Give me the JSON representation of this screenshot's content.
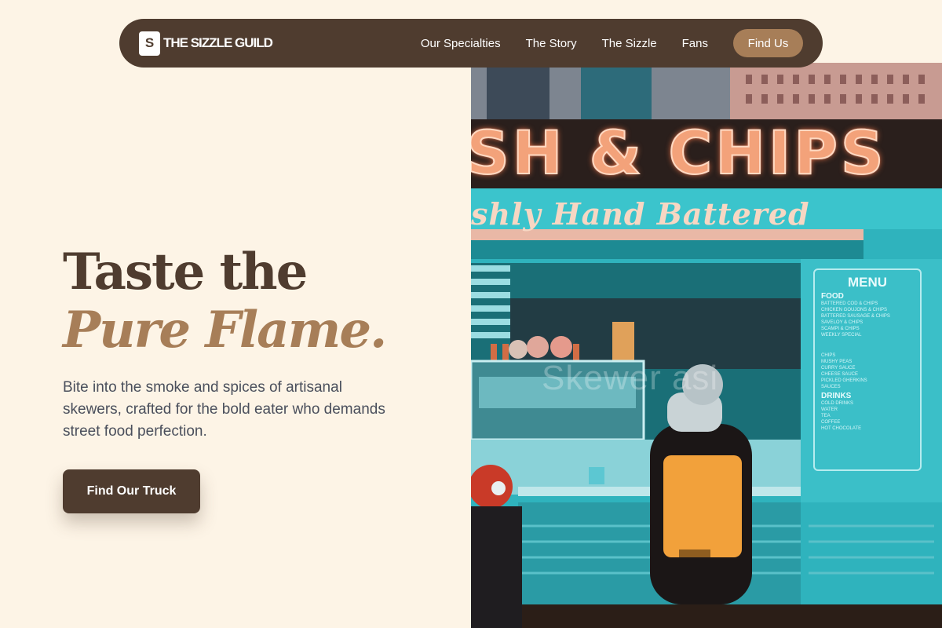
{
  "brand": {
    "mark": "S",
    "name": "THE SIZZLE GUILD"
  },
  "nav": {
    "links": [
      {
        "label": "Our Specialties"
      },
      {
        "label": "The Story"
      },
      {
        "label": "The Sizzle"
      },
      {
        "label": "Fans"
      }
    ],
    "cta": "Find Us"
  },
  "hero": {
    "title_line1": "Taste the",
    "title_line2": "Pure Flame.",
    "subtitle": "Bite into the smoke and spices of artisanal skewers, crafted for the bold eater who demands street food perfection.",
    "cta": "Find Our Truck"
  },
  "photo": {
    "sign_top": "SH & CHIPS",
    "sign_script": "shly Hand Battered",
    "faded_overlay": "Skewer asi",
    "menu": {
      "title": "MENU",
      "food_heading": "FOOD",
      "food_items": [
        "BATTERED COD & CHIPS",
        "CHICKEN GOUJONS & CHIPS",
        "BATTERED SAUSAGE & CHIPS",
        "SAVELOY & CHIPS",
        "SCAMPI & CHIPS",
        "WEEKLY SPECIAL"
      ],
      "sides": [
        "CHIPS",
        "MUSHY PEAS",
        "CURRY SAUCE",
        "CHEESE SAUCE",
        "PICKLED GHERKINS",
        "SAUCES"
      ],
      "drinks_heading": "DRINKS",
      "drinks": [
        "COLD DRINKS",
        "WATER",
        "TEA",
        "COFFEE",
        "HOT CHOCOLATE"
      ]
    }
  },
  "colors": {
    "background": "#fdf4e6",
    "brown_dark": "#4f3c2f",
    "brown_accent": "#a77e58",
    "body_text": "#4a4f5c",
    "truck_teal": "#2fb3bd"
  },
  "icons": {
    "brand_mark": "logo-square-icon"
  }
}
